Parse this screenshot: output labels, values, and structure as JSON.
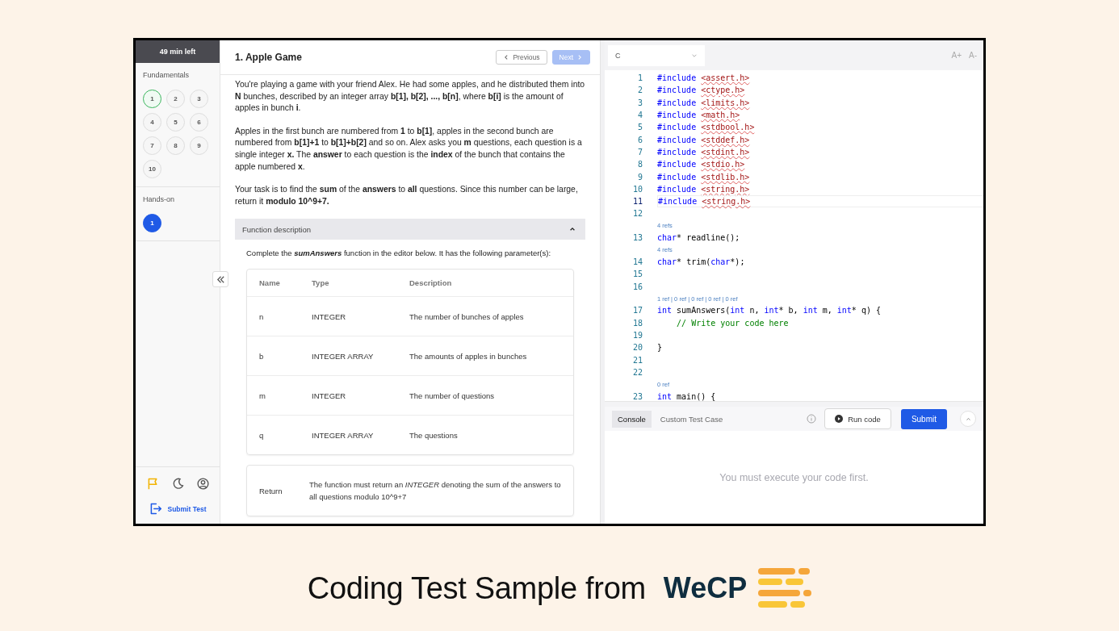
{
  "sidebar": {
    "timer": "49 min left",
    "sections": [
      {
        "title": "Fundamentals",
        "questions": [
          {
            "label": "1",
            "attempted": true,
            "selected": false
          },
          {
            "label": "2",
            "attempted": false,
            "selected": false
          },
          {
            "label": "3",
            "attempted": false,
            "selected": false
          },
          {
            "label": "4",
            "attempted": false,
            "selected": false
          },
          {
            "label": "5",
            "attempted": false,
            "selected": false
          },
          {
            "label": "6",
            "attempted": false,
            "selected": false
          },
          {
            "label": "7",
            "attempted": false,
            "selected": false
          },
          {
            "label": "8",
            "attempted": false,
            "selected": false
          },
          {
            "label": "9",
            "attempted": false,
            "selected": false
          },
          {
            "label": "10",
            "attempted": false,
            "selected": false
          }
        ]
      },
      {
        "title": "Hands-on",
        "questions": [
          {
            "label": "1",
            "attempted": false,
            "selected": true
          }
        ]
      }
    ],
    "submit": "Submit Test"
  },
  "problem": {
    "title": "1. Apple Game",
    "previous": {
      "label": "Previous",
      "disabled": false
    },
    "next": {
      "label": "Next",
      "disabled": true
    },
    "paragraphs": [
      "You're playing a game with your friend Alex. He had some apples, and he distributed them into **N** bunches, described by an integer array **b[1], b[2], ..., b[n]**, where **b[i]** is the amount of apples in bunch **i**.",
      "Apples in the first bunch are numbered from **1** to **b[1]**, apples in the second bunch are numbered from **b[1]+1** to **b[1]+b[2]** and so on. Alex asks you **m** questions, each question is a single integer **x.** The **answer** to each question is the **index** of the bunch that contains the apple numbered **x**.",
      "Your task is to find the **sum** of the **answers** to **all** questions. Since this number can be large, return it **modulo 10^9+7.**"
    ],
    "function_description": {
      "title": "Function description",
      "expanded": true,
      "intro": "Complete the **sumAnswers** function in the editor below. It has the following parameter(s):",
      "columns": [
        "Name",
        "Type",
        "Description"
      ],
      "rows": [
        [
          "n",
          "INTEGER",
          "The number of bunches of apples"
        ],
        [
          "b",
          "INTEGER ARRAY",
          "The amounts of apples in bunches"
        ],
        [
          "m",
          "INTEGER",
          "The number of questions"
        ],
        [
          "q",
          "INTEGER ARRAY",
          "The questions"
        ]
      ],
      "return": {
        "label": "Return",
        "text": "The function must return an *INTEGER* denoting the sum of the answers to all questions modulo 10^9+7"
      }
    }
  },
  "editor": {
    "language": "C",
    "font_buttons": [
      "A+",
      "A-"
    ],
    "lines": [
      {
        "kind": "code",
        "number": "1",
        "current": false,
        "tokens": [
          {
            "kind": "directive",
            "text": "#include"
          },
          {
            "kind": "header",
            "text": "<assert.h>"
          }
        ]
      },
      {
        "kind": "code",
        "number": "2",
        "current": false,
        "tokens": [
          {
            "kind": "directive",
            "text": "#include"
          },
          {
            "kind": "header",
            "text": "<ctype.h>"
          }
        ]
      },
      {
        "kind": "code",
        "number": "3",
        "current": false,
        "tokens": [
          {
            "kind": "directive",
            "text": "#include"
          },
          {
            "kind": "header",
            "text": "<limits.h>"
          }
        ]
      },
      {
        "kind": "code",
        "number": "4",
        "current": false,
        "tokens": [
          {
            "kind": "directive",
            "text": "#include"
          },
          {
            "kind": "header",
            "text": "<math.h>"
          }
        ]
      },
      {
        "kind": "code",
        "number": "5",
        "current": false,
        "tokens": [
          {
            "kind": "directive",
            "text": "#include"
          },
          {
            "kind": "header",
            "text": "<stdbool.h>"
          }
        ]
      },
      {
        "kind": "code",
        "number": "6",
        "current": false,
        "tokens": [
          {
            "kind": "directive",
            "text": "#include"
          },
          {
            "kind": "header",
            "text": "<stddef.h>"
          }
        ]
      },
      {
        "kind": "code",
        "number": "7",
        "current": false,
        "tokens": [
          {
            "kind": "directive",
            "text": "#include"
          },
          {
            "kind": "header",
            "text": "<stdint.h>"
          }
        ]
      },
      {
        "kind": "code",
        "number": "8",
        "current": false,
        "tokens": [
          {
            "kind": "directive",
            "text": "#include"
          },
          {
            "kind": "header",
            "text": "<stdio.h>"
          }
        ]
      },
      {
        "kind": "code",
        "number": "9",
        "current": false,
        "tokens": [
          {
            "kind": "directive",
            "text": "#include"
          },
          {
            "kind": "header",
            "text": "<stdlib.h>"
          }
        ]
      },
      {
        "kind": "code",
        "number": "10",
        "current": false,
        "tokens": [
          {
            "kind": "directive",
            "text": "#include"
          },
          {
            "kind": "header",
            "text": "<string.h>"
          }
        ]
      },
      {
        "kind": "code",
        "number": "11",
        "current": true,
        "tokens": [
          {
            "kind": "directive",
            "text": "#include"
          },
          {
            "kind": "header",
            "text": "<string.h>"
          }
        ]
      },
      {
        "kind": "code",
        "number": "12",
        "current": false
      },
      {
        "kind": "lens",
        "text": "4 refs"
      },
      {
        "kind": "code",
        "number": "13",
        "current": false,
        "tokens": [
          {
            "kind": "keyword",
            "text": "char"
          },
          {
            "kind": "plain",
            "text": "* readline();"
          }
        ]
      },
      {
        "kind": "lens",
        "text": "4 refs"
      },
      {
        "kind": "code",
        "number": "14",
        "current": false,
        "tokens": [
          {
            "kind": "keyword",
            "text": "char"
          },
          {
            "kind": "plain",
            "text": "* trim("
          },
          {
            "kind": "keyword",
            "text": "char"
          },
          {
            "kind": "plain",
            "text": "*);"
          }
        ]
      },
      {
        "kind": "code",
        "number": "15",
        "current": false
      },
      {
        "kind": "code",
        "number": "16",
        "current": false
      },
      {
        "kind": "lens",
        "text": "1 ref | 0 ref | 0 ref | 0 ref | 0 ref"
      },
      {
        "kind": "code",
        "number": "17",
        "current": false,
        "tokens": [
          {
            "kind": "keyword",
            "text": "int"
          },
          {
            "kind": "plain",
            "text": " sumAnswers("
          },
          {
            "kind": "keyword",
            "text": "int"
          },
          {
            "kind": "plain",
            "text": " n, "
          },
          {
            "kind": "keyword",
            "text": "int"
          },
          {
            "kind": "plain",
            "text": "* b, "
          },
          {
            "kind": "keyword",
            "text": "int"
          },
          {
            "kind": "plain",
            "text": " m, "
          },
          {
            "kind": "keyword",
            "text": "int"
          },
          {
            "kind": "plain",
            "text": "* q) {"
          }
        ]
      },
      {
        "kind": "code",
        "number": "18",
        "current": false,
        "tokens": [
          {
            "kind": "comment",
            "text": "    // Write your code here"
          }
        ]
      },
      {
        "kind": "code",
        "number": "19",
        "current": false
      },
      {
        "kind": "code",
        "number": "20",
        "current": false,
        "tokens": [
          {
            "kind": "plain",
            "text": "}"
          }
        ]
      },
      {
        "kind": "code",
        "number": "21",
        "current": false
      },
      {
        "kind": "code",
        "number": "22",
        "current": false
      },
      {
        "kind": "lens",
        "text": "0 ref"
      },
      {
        "kind": "code",
        "number": "23",
        "current": false,
        "tokens": [
          {
            "kind": "keyword",
            "text": "int"
          },
          {
            "kind": "plain",
            "text": " main() {"
          }
        ]
      }
    ]
  },
  "console": {
    "tabs": [
      {
        "label": "Console",
        "selected": true
      },
      {
        "label": "Custom Test Case",
        "selected": false
      }
    ],
    "run": "Run code",
    "submit": "Submit",
    "message": "You must execute your code first."
  },
  "caption": {
    "text": "Coding Test Sample from",
    "brand": "WeCP"
  }
}
